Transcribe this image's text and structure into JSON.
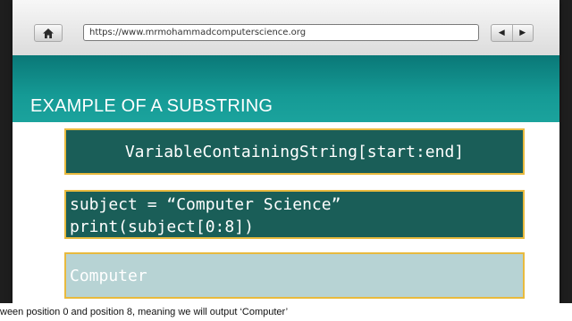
{
  "browser": {
    "url": "https://www.mrmohammadcomputerscience.org",
    "home_icon": "home-icon",
    "back_label": "◀",
    "forward_label": "▶"
  },
  "slide": {
    "title": "EXAMPLE OF A SUBSTRING",
    "syntax": "VariableContainingString[start:end]",
    "code_lines": [
      "subject = “Computer Science”",
      "print(subject[0:8])"
    ],
    "output": "Computer"
  },
  "caption": "ween position 0 and position 8, meaning we will output ‘Computer’",
  "colors": {
    "teal": "#159a95",
    "box_dark": "#1a5e58",
    "box_light": "#b7d3d4",
    "border_gold": "#e8ba3e"
  }
}
